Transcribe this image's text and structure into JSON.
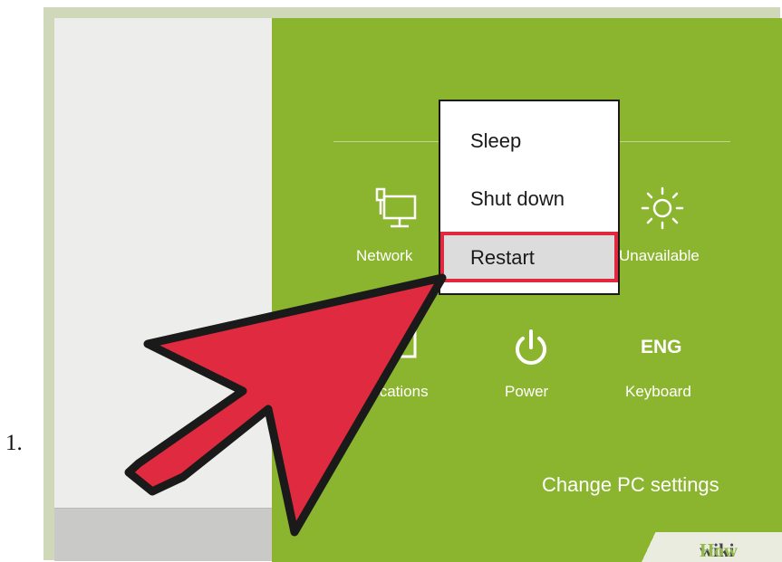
{
  "step": {
    "number": "1."
  },
  "quick_settings": {
    "network": {
      "label": "Network",
      "icon": "network-icon"
    },
    "brightness": {
      "label": "Unavailable",
      "icon": "brightness-icon"
    },
    "notifications": {
      "label": "Notifications",
      "icon": "notifications-icon"
    },
    "power": {
      "label": "Power",
      "icon": "power-icon"
    },
    "keyboard": {
      "label": "Keyboard",
      "icon_text": "ENG"
    }
  },
  "power_menu": {
    "items": [
      {
        "label": "Sleep"
      },
      {
        "label": "Shut down"
      },
      {
        "label": "Restart",
        "highlighted": true
      }
    ]
  },
  "change_pc_settings": "Change PC settings",
  "watermark": {
    "wiki": "wiki",
    "how": "How"
  },
  "colors": {
    "charm_background": "#8cb52f",
    "highlight_border": "#e0283f",
    "arrow_fill": "#e02a3f"
  }
}
